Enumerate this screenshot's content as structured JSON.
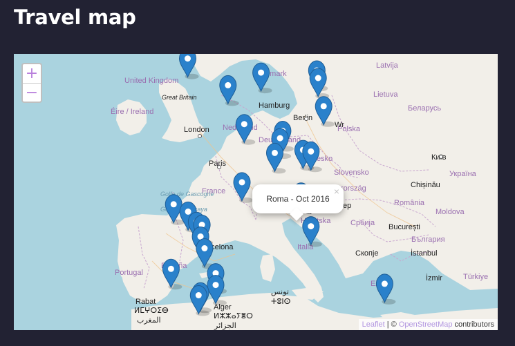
{
  "page": {
    "title": "Travel map"
  },
  "map": {
    "zoom_in_label": "+",
    "zoom_out_label": "−",
    "popup": {
      "text": "Roma - Oct 2016",
      "close": "×"
    },
    "attribution": {
      "leaflet": "Leaflet",
      "separator": " | © ",
      "osm": "OpenStreetMap",
      "suffix": " contributors"
    },
    "colors": {
      "water": "#aad3df",
      "land": "#f2efe9",
      "marker": "#2a81cb",
      "marker_stroke": "#1f5e96"
    },
    "labels": {
      "country": [
        "United Kingdom",
        "Éire / Ireland",
        "Nederland",
        "Danmark",
        "Deutschland",
        "Polska",
        "Česko",
        "France",
        "Slovensko",
        "Magyarország",
        "România",
        "Hrvatska",
        "Србија",
        "България",
        "Italia",
        "Portugal",
        "España",
        "Ελλάς",
        "Türkiye",
        "Latvija",
        "Lietuva",
        "Беларусь",
        "Україна",
        "Moldova"
      ],
      "city": [
        "Great Britain",
        "London",
        "Hamburg",
        "Berlin",
        "Paris",
        "Київ",
        "Chișinău",
        "Barcelona",
        "București",
        "İstanbul",
        "Скопје",
        "Rabat",
        "Alger",
        "İzmir"
      ],
      "sea": [
        "Golfe de Gascogne",
        "Golfo de Vizcaya"
      ],
      "script": [
        "ⵍⵎⵖⵔⵉⴱ",
        "المغرب",
        "ⵍⵣⵣⴰⵢⴻⵔ",
        "الجزائر",
        "تونس",
        "ⵜⵓⵏⵙ",
        "ep",
        "Wr",
        "lb"
      ]
    },
    "markers": [
      {
        "lat": 53.33,
        "lon": -6.26
      },
      {
        "lat": 51.51,
        "lon": -0.13
      },
      {
        "lat": 52.37,
        "lon": 4.9
      },
      {
        "lat": 52.52,
        "lon": 13.4
      },
      {
        "lat": 52.0,
        "lon": 13.6
      },
      {
        "lat": 50.08,
        "lon": 14.44
      },
      {
        "lat": 48.86,
        "lon": 2.35
      },
      {
        "lat": 48.4,
        "lon": 8.2
      },
      {
        "lat": 47.9,
        "lon": 7.8
      },
      {
        "lat": 46.9,
        "lon": 7.0
      },
      {
        "lat": 47.1,
        "lon": 11.3
      },
      {
        "lat": 47.0,
        "lon": 12.5
      },
      {
        "lat": 44.9,
        "lon": 2.0
      },
      {
        "lat": 44.2,
        "lon": 11.0
      },
      {
        "lat": 41.9,
        "lon": 12.5
      },
      {
        "lat": 43.4,
        "lon": -8.4
      },
      {
        "lat": 42.9,
        "lon": -6.2
      },
      {
        "lat": 42.2,
        "lon": -4.9
      },
      {
        "lat": 42.0,
        "lon": -4.1
      },
      {
        "lat": 41.2,
        "lon": -4.3
      },
      {
        "lat": 40.4,
        "lon": -3.7
      },
      {
        "lat": 39.0,
        "lon": -8.8
      },
      {
        "lat": 38.7,
        "lon": -2.0
      },
      {
        "lat": 37.9,
        "lon": -2.0
      },
      {
        "lat": 37.4,
        "lon": -4.3
      },
      {
        "lat": 37.2,
        "lon": -4.6
      },
      {
        "lat": 37.98,
        "lon": 23.73
      }
    ]
  }
}
